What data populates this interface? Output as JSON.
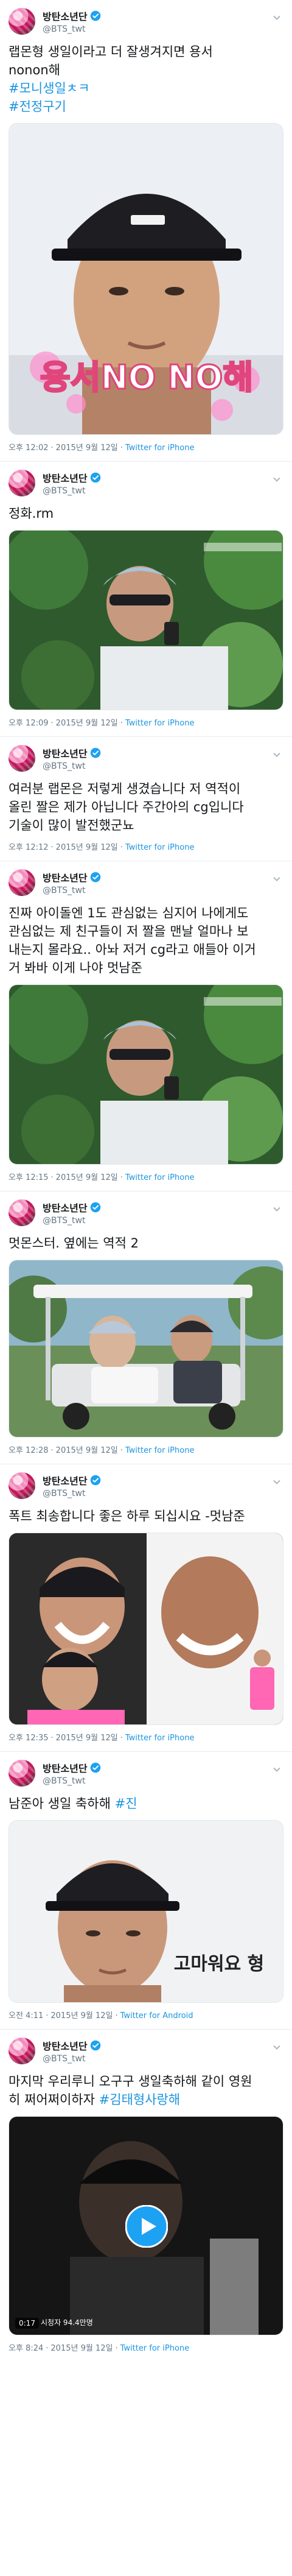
{
  "account": {
    "name": "방탄소년단",
    "handle": "@BTS_twt"
  },
  "colors": {
    "link": "#1b95e0",
    "meta": "#657786",
    "verified": "#1da1f2"
  },
  "icons": {
    "verified": "verified-badge-icon",
    "menu": "chevron-down-icon",
    "play": "play-icon"
  },
  "tweets": [
    {
      "lines": [
        {
          "t": "랩몬형 생일이라고 더 잘생겨지면 용서",
          "tag": false
        },
        {
          "t": "nonon해",
          "tag": false
        },
        {
          "t": "#모니생일ㅊㅋ",
          "tag": true
        },
        {
          "t": "#전정구기",
          "tag": true
        }
      ],
      "image": {
        "caption": "용서NO NO해"
      },
      "time": "오후 12:02",
      "date": "2015년 9월 12일",
      "app": "Twitter for iPhone"
    },
    {
      "lines": [
        {
          "t": "정화.rm",
          "tag": false
        }
      ],
      "image": {
        "caption": ""
      },
      "time": "오후 12:09",
      "date": "2015년 9월 12일",
      "app": "Twitter for iPhone"
    },
    {
      "lines": [
        {
          "t": "여러분 랩몬은 저렇게 생겼습니다 저 역적이",
          "tag": false
        },
        {
          "t": "올린 짤은 제가 아닙니다 주간아의 cg입니다",
          "tag": false
        },
        {
          "t": "기술이 많이 발전했군뇨",
          "tag": false
        }
      ],
      "image": null,
      "time": "오후 12:12",
      "date": "2015년 9월 12일",
      "app": "Twitter for iPhone"
    },
    {
      "lines": [
        {
          "t": "진짜 아이돌엔 1도 관심없는 심지어 나에게도",
          "tag": false
        },
        {
          "t": "관심없는 제 친구들이 저 짤을 맨날 얼마나 보",
          "tag": false
        },
        {
          "t": "내는지 몰라요.. 아놔 저거 cg라고 애들아 이거",
          "tag": false
        },
        {
          "t": "거 봐바 이게 나야 멋남준",
          "tag": false
        }
      ],
      "image": {
        "caption": ""
      },
      "time": "오후 12:15",
      "date": "2015년 9월 12일",
      "app": "Twitter for iPhone"
    },
    {
      "lines": [
        {
          "t": "멋몬스터. 옆에는 역적 2",
          "tag": false
        }
      ],
      "image": {
        "caption": ""
      },
      "time": "오후 12:28",
      "date": "2015년 9월 12일",
      "app": "Twitter for iPhone"
    },
    {
      "lines": [
        {
          "t": "폭트 최송합니다 좋은 하루 되십시요 -멋남준",
          "tag": false
        }
      ],
      "image": {
        "caption": ""
      },
      "time": "오후 12:35",
      "date": "2015년 9월 12일",
      "app": "Twitter for iPhone"
    },
    {
      "lines": [
        {
          "t": "남준아 생일 축하해 ",
          "tag": false,
          "inline_tag": "#진"
        }
      ],
      "image": {
        "caption": "고마워요 형"
      },
      "time": "오전 4:11",
      "date": "2015년 9월 12일",
      "app": "Twitter for Android"
    },
    {
      "lines": [
        {
          "t": "마지막 우리루니 오구구 생일축하해 같이 영원",
          "tag": false
        },
        {
          "t": "히 쩌어쩌이하자 ",
          "tag": false,
          "inline_tag": "#김태형사랑해"
        }
      ],
      "video": {
        "duration": "0:17",
        "views": "시청자 94.4만명"
      },
      "time": "오후 8:24",
      "date": "2015년 9월 12일",
      "app": "Twitter for iPhone"
    }
  ]
}
